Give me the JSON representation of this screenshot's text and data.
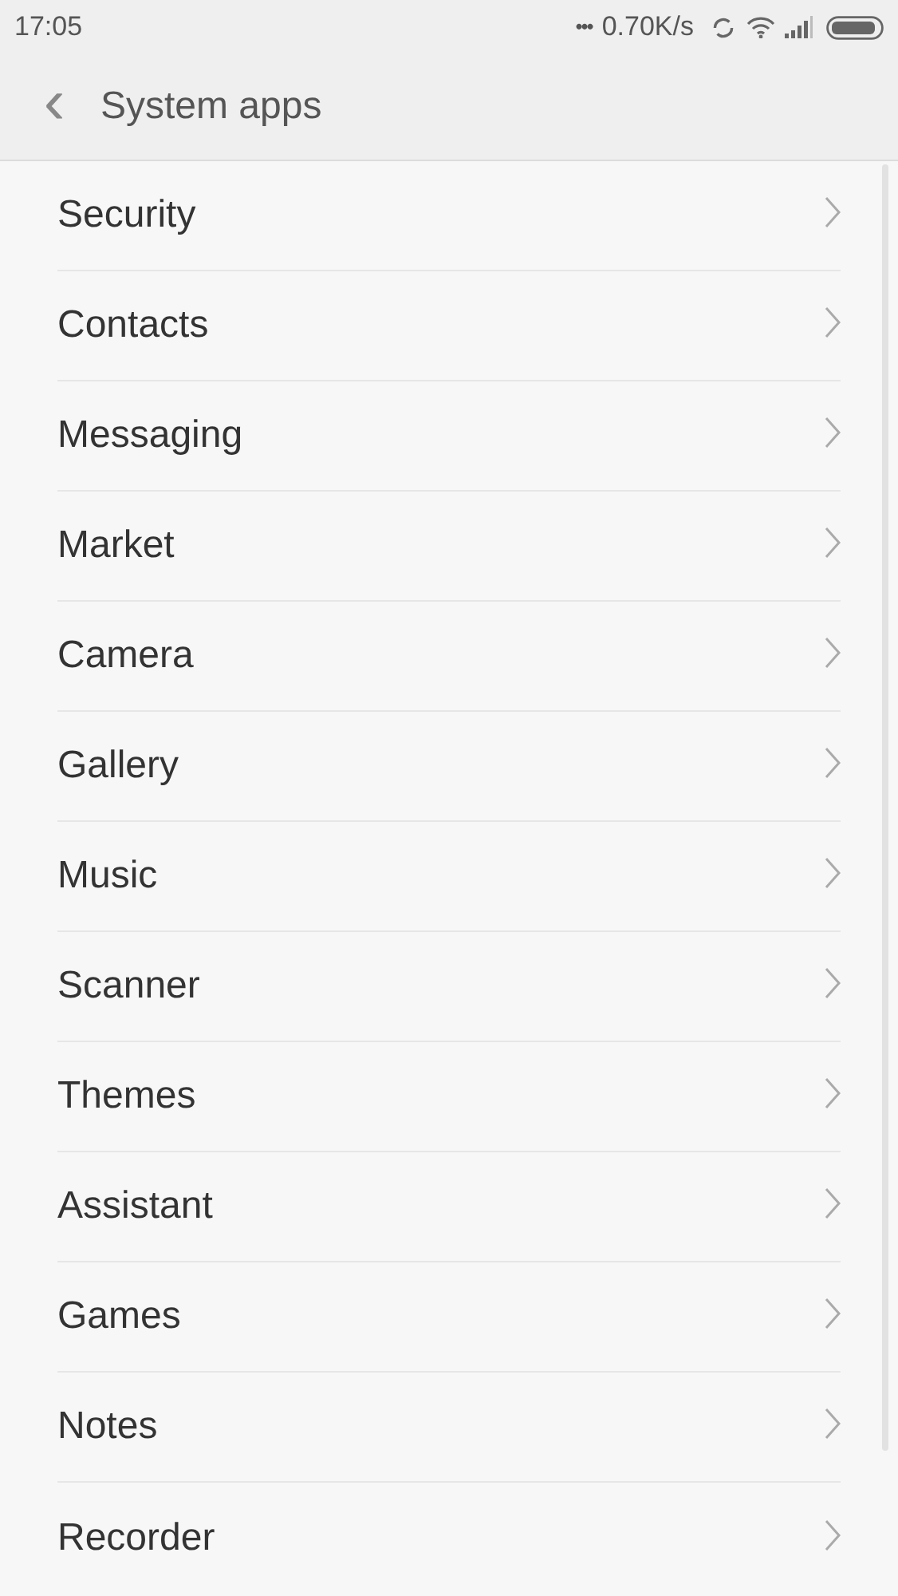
{
  "status_bar": {
    "time": "17:05",
    "dots": "•••",
    "speed": "0.70K/s"
  },
  "header": {
    "back": "‹",
    "title": "System apps"
  },
  "items": [
    {
      "label": "Security"
    },
    {
      "label": "Contacts"
    },
    {
      "label": "Messaging"
    },
    {
      "label": "Market"
    },
    {
      "label": "Camera"
    },
    {
      "label": "Gallery"
    },
    {
      "label": "Music"
    },
    {
      "label": "Scanner"
    },
    {
      "label": "Themes"
    },
    {
      "label": "Assistant"
    },
    {
      "label": "Games"
    },
    {
      "label": "Notes"
    },
    {
      "label": "Recorder"
    }
  ]
}
